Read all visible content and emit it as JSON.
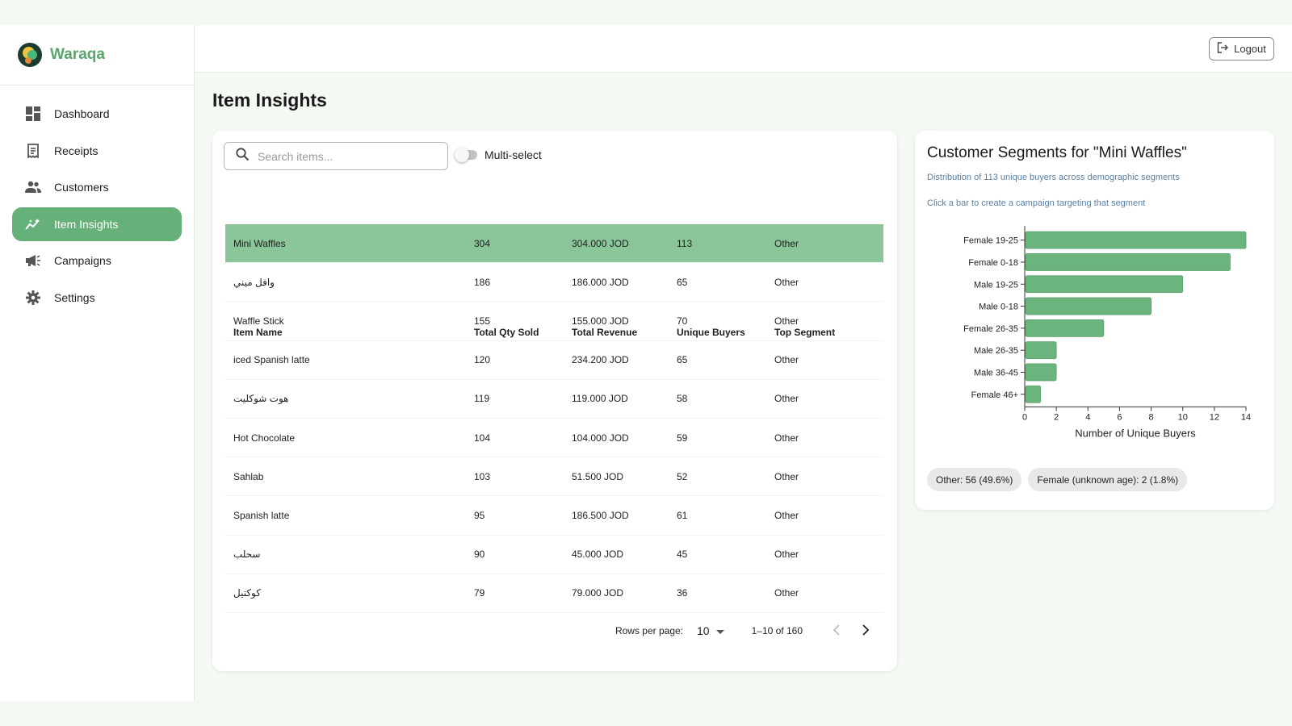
{
  "brand": {
    "name": "Waraqa"
  },
  "sidebar": {
    "items": [
      {
        "label": "Dashboard",
        "icon": "dashboard-icon"
      },
      {
        "label": "Receipts",
        "icon": "receipt-icon"
      },
      {
        "label": "Customers",
        "icon": "people-icon"
      },
      {
        "label": "Item Insights",
        "icon": "insights-icon",
        "active": true
      },
      {
        "label": "Campaigns",
        "icon": "megaphone-icon"
      },
      {
        "label": "Settings",
        "icon": "gear-icon"
      }
    ]
  },
  "topbar": {
    "logout_label": "Logout"
  },
  "page": {
    "title": "Item Insights"
  },
  "search": {
    "placeholder": "Search items..."
  },
  "multiselect": {
    "label": "Multi-select",
    "enabled": false
  },
  "table": {
    "headers": [
      "Item Name",
      "Total Qty Sold",
      "Total Revenue",
      "Unique Buyers",
      "Top Segment"
    ],
    "rows": [
      [
        "Mini Waffles",
        "304",
        "304.000 JOD",
        "113",
        "Other"
      ],
      [
        "وافل ميني",
        "186",
        "186.000 JOD",
        "65",
        "Other"
      ],
      [
        "Waffle Stick",
        "155",
        "155.000 JOD",
        "70",
        "Other"
      ],
      [
        "iced Spanish latte",
        "120",
        "234.200 JOD",
        "65",
        "Other"
      ],
      [
        "هوت شوكليت",
        "119",
        "119.000 JOD",
        "58",
        "Other"
      ],
      [
        "Hot Chocolate",
        "104",
        "104.000 JOD",
        "59",
        "Other"
      ],
      [
        "Sahlab",
        "103",
        "51.500 JOD",
        "52",
        "Other"
      ],
      [
        "Spanish latte",
        "95",
        "186.500 JOD",
        "61",
        "Other"
      ],
      [
        "سحلب",
        "90",
        "45.000 JOD",
        "45",
        "Other"
      ],
      [
        "كوكتيل",
        "79",
        "79.000 JOD",
        "36",
        "Other"
      ]
    ],
    "selected_row": 0
  },
  "pagination": {
    "rows_per_page_label": "Rows per page:",
    "rows_per_page": "10",
    "range": "1–10 of 160"
  },
  "segments": {
    "title": "Customer Segments for \"Mini Waffles\"",
    "subtitle": "Distribution of 113 unique buyers across demographic segments",
    "hint": "Click a bar to create a campaign targeting that segment",
    "chips": [
      "Other: 56 (49.6%)",
      "Female (unknown age): 2 (1.8%)"
    ]
  },
  "colors": {
    "accent": "#66b07a",
    "bar": "#6cb47e",
    "selected_row": "#8ac69a",
    "brand": "#5aa56b"
  },
  "chart_data": {
    "type": "bar",
    "orientation": "horizontal",
    "categories": [
      "Female 19-25",
      "Female 0-18",
      "Male 19-25",
      "Male 0-18",
      "Female 26-35",
      "Male 26-35",
      "Male 36-45",
      "Female 46+"
    ],
    "values": [
      14,
      13,
      10,
      8,
      5,
      2,
      2,
      1
    ],
    "xlabel": "Number of Unique Buyers",
    "ylabel": "",
    "xlim": [
      0,
      14
    ],
    "xticks": [
      0,
      2,
      4,
      6,
      8,
      10,
      12,
      14
    ],
    "grid": false
  }
}
